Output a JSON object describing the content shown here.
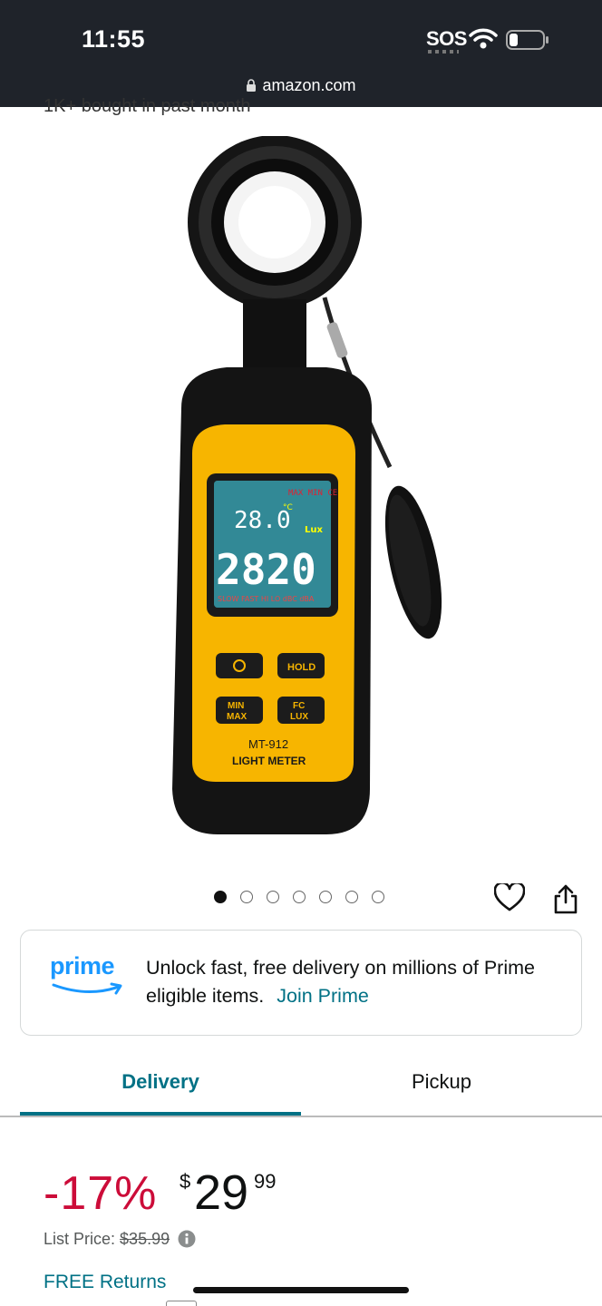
{
  "status_bar": {
    "time": "11:55",
    "sos": "SOS",
    "url": "amazon.com",
    "icons": [
      "wifi-icon",
      "battery-icon",
      "lock-icon"
    ]
  },
  "product": {
    "purchase_note": "1K+ bought in past month",
    "image": {
      "model": "MT-912",
      "name": "LIGHT METER",
      "display_top": "28.0",
      "display_main": "2820",
      "display_unit": "Lux",
      "display_temp_unit": "°C",
      "display_flags": [
        "MAX",
        "MIN",
        "CE"
      ],
      "display_bottom": [
        "SLOW",
        "FAST",
        "HI",
        "LO",
        "dBC",
        "dBA"
      ],
      "buttons": [
        "HOLD",
        "MIN",
        "MAX",
        "FC",
        "LUX"
      ]
    },
    "carousel": {
      "count": 7,
      "active": 0
    }
  },
  "prime": {
    "logo": "prime",
    "message": "Unlock fast, free delivery on millions of Prime eligible items.",
    "join_label": "Join Prime"
  },
  "tabs": [
    {
      "label": "Delivery",
      "selected": true
    },
    {
      "label": "Pickup",
      "selected": false
    }
  ],
  "pricing": {
    "discount": "-17%",
    "currency": "$",
    "whole": "29",
    "fraction": "99",
    "list_price_label": "List Price:",
    "list_price": "$35.99",
    "returns": "FREE Returns"
  },
  "colors": {
    "status_bar": "#1f232a",
    "link": "#007185",
    "discount": "#cc0c39",
    "prime_blue": "#1a98ff",
    "meter_yellow": "#f7b500"
  }
}
